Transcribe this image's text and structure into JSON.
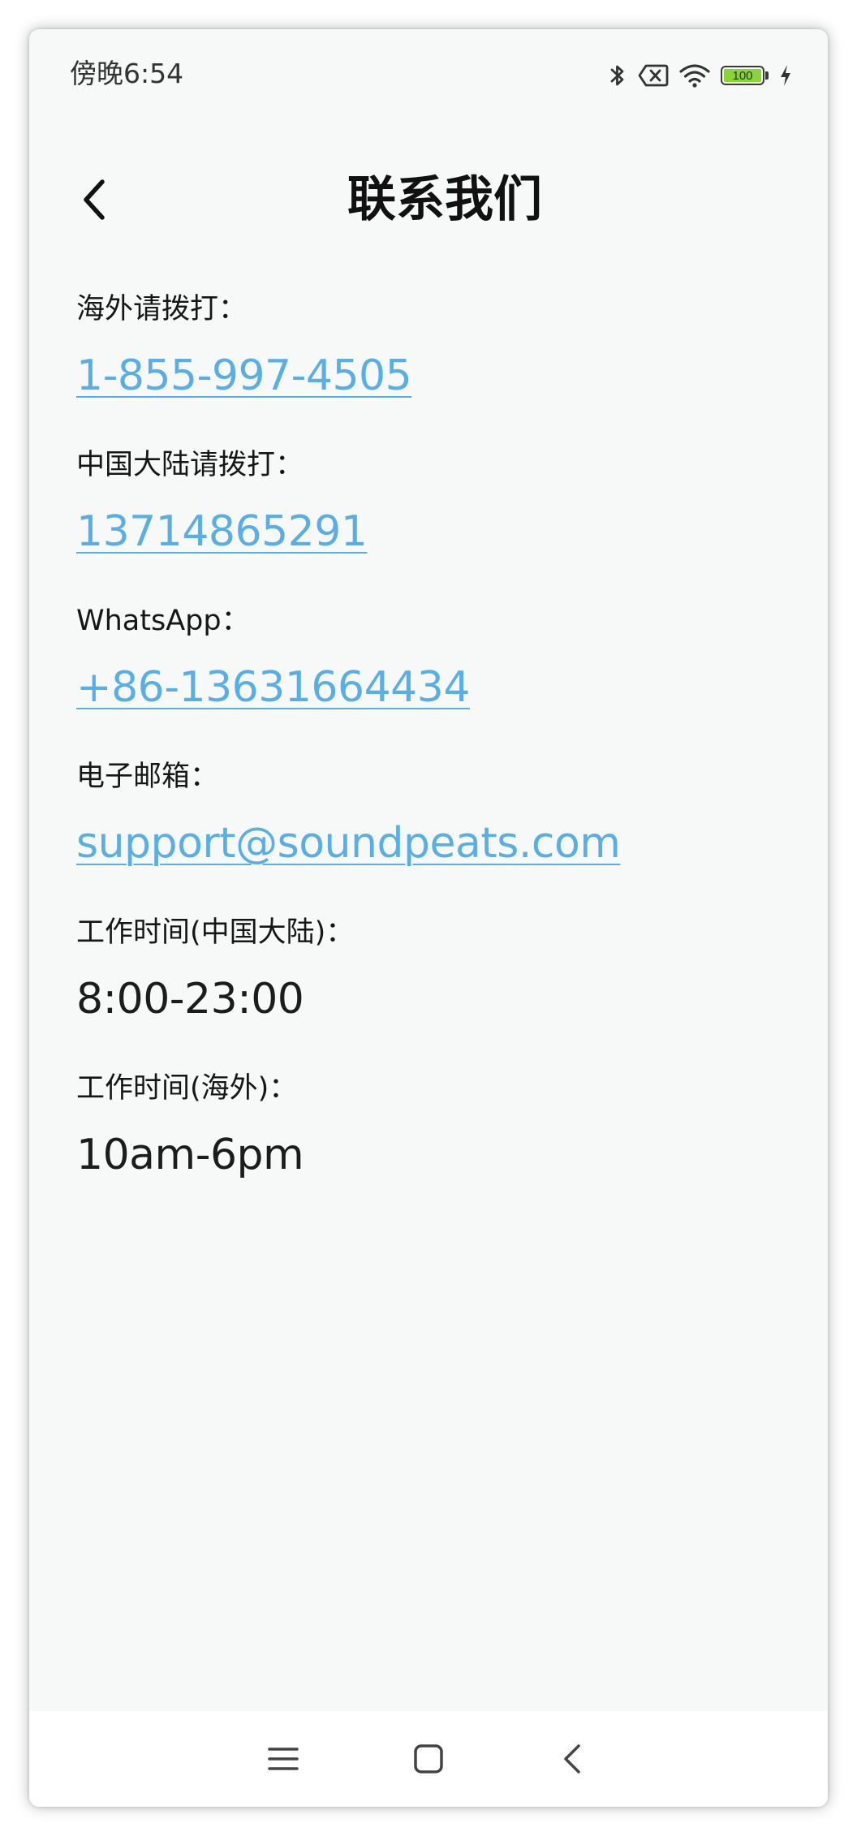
{
  "status_bar": {
    "time": "傍晚6:54",
    "battery_level": "100",
    "icons": [
      "bluetooth-icon",
      "no-sim-icon",
      "wifi-icon",
      "battery-icon",
      "charging-icon"
    ]
  },
  "header": {
    "title": "联系我们",
    "back_icon": "chevron-left-icon"
  },
  "contacts": [
    {
      "label": "海外请拨打：",
      "value": "1-855-997-4505",
      "type": "link"
    },
    {
      "label": "中国大陆请拨打：",
      "value": "13714865291",
      "type": "link"
    },
    {
      "label": "WhatsApp：",
      "value": "+86-13631664434",
      "type": "link"
    },
    {
      "label": "电子邮箱：",
      "value": "support@soundpeats.com",
      "type": "link"
    },
    {
      "label": "工作时间(中国大陆)：",
      "value": "8:00-23:00",
      "type": "text"
    },
    {
      "label": "工作时间(海外)：",
      "value": "10am-6pm",
      "type": "text"
    }
  ],
  "nav_bar": {
    "icons": [
      "menu-icon",
      "home-icon",
      "back-icon"
    ]
  },
  "colors": {
    "link": "#5aaee6",
    "background": "#f7f9f9",
    "text": "#161616",
    "battery": "#8bd437"
  }
}
